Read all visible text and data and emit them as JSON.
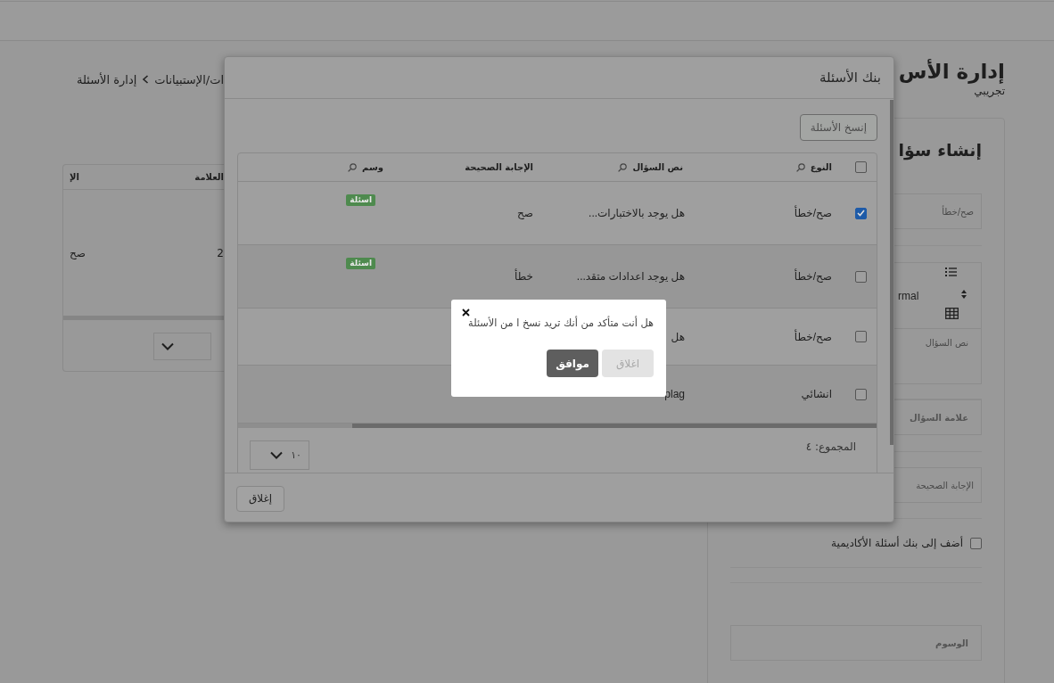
{
  "page": {
    "title": "إدارة الأس",
    "subtitle": "تجريبي",
    "breadcrumb": [
      {
        "label": "ات/الإستبيانات"
      },
      {
        "label": "إدارة الأسئلة"
      }
    ]
  },
  "list_table": {
    "columns": [
      "العلامة",
      "الإ"
    ],
    "rows": [
      [
        "2",
        "صح"
      ]
    ]
  },
  "form": {
    "heading": "إنشاء سؤا",
    "type_value": "صح/خطأ",
    "editor": {
      "style_value": "rmal",
      "placeholder": "نص السؤال"
    },
    "mark_placeholder": "علامة السؤال",
    "answer_placeholder": "الإجابة الصحيحة",
    "add_to_bank": {
      "label": "أضف إلى بنك أسئلة الأكاديمية",
      "checked": false
    },
    "tags_placeholder": "الوسوم"
  },
  "modal": {
    "title": "بنك الأسئلة",
    "copy_button": "إنسخ الأسئلة",
    "select_all_checked": false,
    "columns": [
      {
        "label": "النوع",
        "searchable": true
      },
      {
        "label": "نص السؤال",
        "searchable": true
      },
      {
        "label": "الإجابة الصحيحة",
        "searchable": false
      },
      {
        "label": "وسم",
        "searchable": true
      }
    ],
    "rows": [
      {
        "checked": true,
        "type": "صح/خطأ",
        "question": "هل يوجد بالاختبارات...",
        "answer": "صح",
        "tag": "اسئلة"
      },
      {
        "checked": false,
        "type": "صح/خطأ",
        "question": "هل يوجد اعدادات متقد...",
        "answer": "خطأ",
        "tag": "اسئلة"
      },
      {
        "checked": false,
        "type": "صح/خطأ",
        "question": "هل"
      },
      {
        "checked": false,
        "type": "انشائي",
        "question": "plag"
      }
    ],
    "total": "المجموع: ٤",
    "page_size": "١٠",
    "close_button": "إغلاق"
  },
  "confirm": {
    "message": "هل أنت متأكد من أنك تريد نسخ ا من الأسئلة",
    "buttons": [
      {
        "label": "اغلاق",
        "kind": "secondary"
      },
      {
        "label": "موافق",
        "kind": "primary"
      }
    ]
  }
}
